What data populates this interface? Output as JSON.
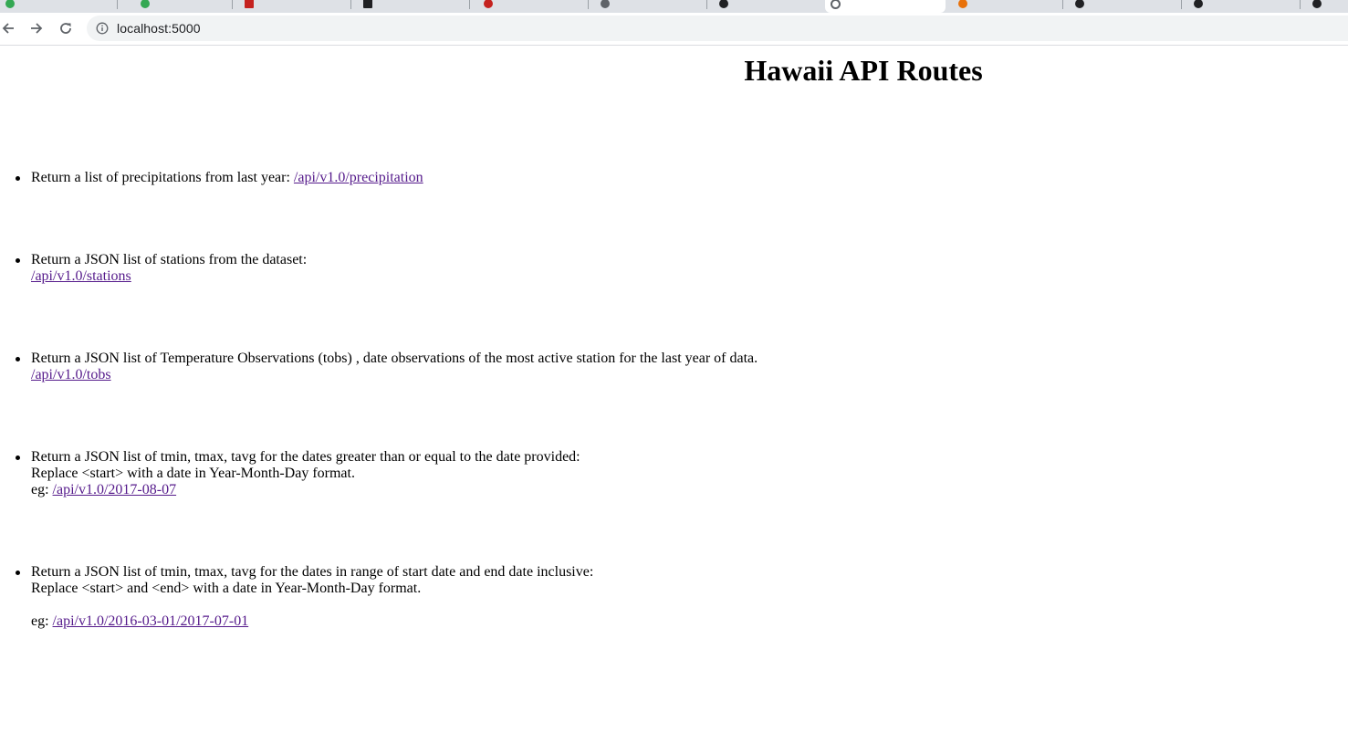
{
  "browser": {
    "url": "localhost:5000"
  },
  "page": {
    "title": "Hawaii API Routes",
    "routes": [
      {
        "text": "Return a list of precipitations from last year: ",
        "link": "/api/v1.0/precipitation"
      },
      {
        "text": "Return a JSON list of stations from the dataset:",
        "link": "/api/v1.0/stations"
      },
      {
        "text": "Return a JSON list of Temperature Observations (tobs) , date observations of the most active station for the last year of data.",
        "link": "/api/v1.0/tobs"
      },
      {
        "text": "Return a JSON list of tmin, tmax, tavg for the dates greater than or equal to the date provided:",
        "note": "Replace <start> with a date in Year-Month-Day format.",
        "eg_prefix": "eg: ",
        "link": "/api/v1.0/2017-08-07"
      },
      {
        "text": "Return a JSON list of tmin, tmax, tavg for the dates in range of start date and end date inclusive:",
        "note": "Replace <start> and <end> with a date in Year-Month-Day format.",
        "eg_prefix": "eg: ",
        "link": "/api/v1.0/2016-03-01/2017-07-01"
      }
    ]
  }
}
